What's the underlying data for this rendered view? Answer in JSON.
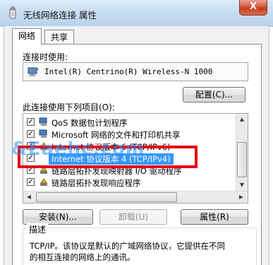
{
  "window": {
    "title": "无线网络连接 属性",
    "close_glyph": "X"
  },
  "tabs": [
    {
      "label": "网络"
    },
    {
      "label": "共享"
    }
  ],
  "connect_using": {
    "label": "连接时使用:",
    "adapter": "Intel(R) Centrino(R) Wireless-N 1000"
  },
  "buttons": {
    "configure": "配置(C)...",
    "install": "安装(N)...",
    "uninstall": "卸载(U)",
    "properties": "属性(R)"
  },
  "items_label": "此连接使用下列项目(O):",
  "items": [
    {
      "label": "QoS 数据包计划程序",
      "checked": true,
      "icon": "network-service-icon"
    },
    {
      "label": "Microsoft 网络的文件和打印机共享",
      "checked": true,
      "icon": "network-service-icon"
    },
    {
      "label": "Internet 协议版本 6 (TCP/IPv6)",
      "checked": true,
      "icon": "protocol-icon"
    },
    {
      "label": "Internet 协议版本 4 (TCP/IPv4)",
      "checked": true,
      "icon": "protocol-icon",
      "selected": true
    },
    {
      "label": "链路层拓扑发现映射器 I/O 驱动程序",
      "checked": true,
      "icon": "protocol-icon"
    },
    {
      "label": "链路层拓扑发现响应程序",
      "checked": true,
      "icon": "protocol-icon"
    }
  ],
  "description": {
    "title": "描述",
    "line1": "TCP/IP。该协议是默认的广域网络协议，它提供在不同",
    "line2": "的相互连接的网络上的通讯。"
  },
  "watermark": "&Eaehc.com",
  "colors": {
    "selection": "#3399ff",
    "highlight_border": "#e60012",
    "title_bar": "#c4daf0"
  }
}
